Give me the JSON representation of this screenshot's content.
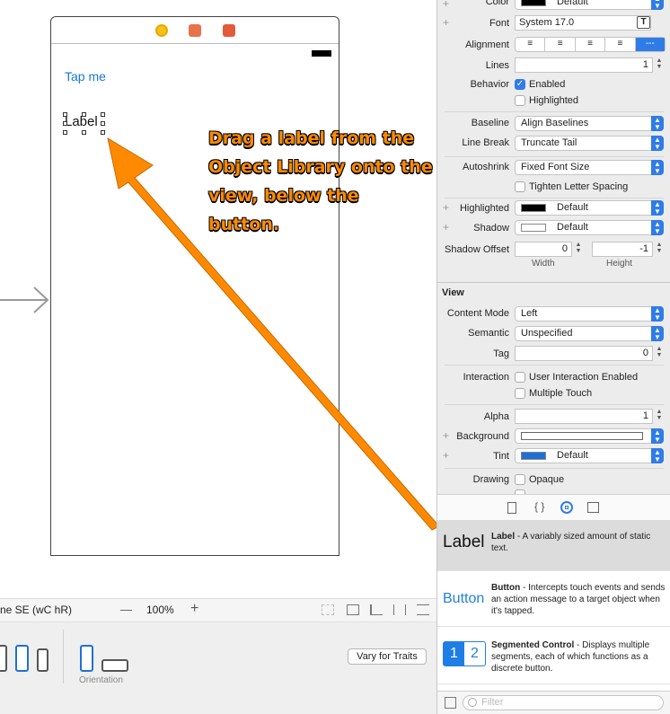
{
  "scene": {
    "button_title": "Tap me",
    "label_text": "Label"
  },
  "callout": {
    "text": "Drag a label from the Object Library onto the view, below the button."
  },
  "canvas_bar": {
    "device_config": "ne SE (wC hR)",
    "zoom": "100%",
    "zoom_out": "—",
    "zoom_in": "+",
    "orientation_label": "Orientation",
    "vary_button": "Vary for Traits"
  },
  "inspector": {
    "color_label": "Color",
    "color_value": "Default",
    "font_label": "Font",
    "font_value": "System 17.0",
    "alignment_label": "Alignment",
    "lines_label": "Lines",
    "lines_value": "1",
    "behavior_label": "Behavior",
    "enabled_label": "Enabled",
    "highlighted_cb_label": "Highlighted",
    "baseline_label": "Baseline",
    "baseline_value": "Align Baselines",
    "linebreak_label": "Line Break",
    "linebreak_value": "Truncate Tail",
    "autoshrink_label": "Autoshrink",
    "autoshrink_value": "Fixed Font Size",
    "tighten_label": "Tighten Letter Spacing",
    "highlighted_label": "Highlighted",
    "highlighted_value": "Default",
    "shadow_label": "Shadow",
    "shadow_value": "Default",
    "shadow_offset_label": "Shadow Offset",
    "shadow_width_value": "0",
    "shadow_height_value": "-1",
    "width_caption": "Width",
    "height_caption": "Height",
    "view_section": "View",
    "content_mode_label": "Content Mode",
    "content_mode_value": "Left",
    "semantic_label": "Semantic",
    "semantic_value": "Unspecified",
    "tag_label": "Tag",
    "tag_value": "0",
    "interaction_label": "Interaction",
    "user_interaction_label": "User Interaction Enabled",
    "multiple_touch_label": "Multiple Touch",
    "alpha_label": "Alpha",
    "alpha_value": "1",
    "background_label": "Background",
    "tint_label": "Tint",
    "tint_value": "Default",
    "drawing_label": "Drawing",
    "opaque_label": "Opaque"
  },
  "library": {
    "items": [
      {
        "icon_text": "Label",
        "name": "Label",
        "desc": " - A variably sized amount of static text."
      },
      {
        "icon_text": "Button",
        "name": "Button",
        "desc": " - Intercepts touch events and sends an action message to a target object when it's tapped."
      },
      {
        "icon_text_1": "1",
        "icon_text_2": "2",
        "name": "Segmented Control",
        "desc": " - Displays multiple segments, each of which functions as a discrete button."
      }
    ],
    "filter_placeholder": "Filter"
  },
  "colors": {
    "accent": "#2f7ce8",
    "callout": "#ff8a00",
    "link": "#1477d6"
  }
}
